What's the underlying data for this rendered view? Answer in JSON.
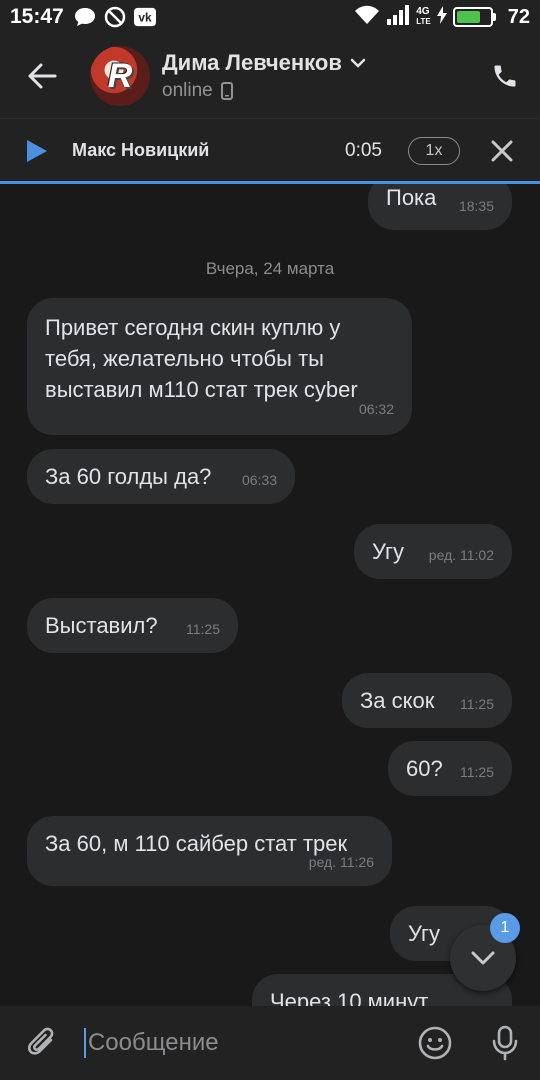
{
  "status_bar": {
    "time": "15:47",
    "net_label": "4G",
    "net_sub": "LTE",
    "battery": "72",
    "battery_level": 0.72
  },
  "header": {
    "contact_name": "Дима Левченков",
    "status": "online",
    "avatar_letter": "R"
  },
  "player": {
    "title": "Макс Новицкий",
    "time": "0:05",
    "speed": "1x"
  },
  "chat": {
    "date_separator": "Вчера, 24 марта",
    "messages": [
      {
        "text": "Пока",
        "time": "18:35",
        "side": "out"
      },
      {
        "text": "Привет сегодня скин куплю у тебя, желательно чтобы ты выставил м110 стат трек cyber",
        "time": "06:32",
        "side": "in"
      },
      {
        "text": "За 60 голды да?",
        "time": "06:33",
        "side": "in"
      },
      {
        "text": "Угу",
        "time": "ред. 11:02",
        "side": "out"
      },
      {
        "text": "Выставил?",
        "time": "11:25",
        "side": "in"
      },
      {
        "text": "За скок",
        "time": "11:25",
        "side": "out"
      },
      {
        "text": "60?",
        "time": "11:25",
        "side": "out"
      },
      {
        "text": "За 60, м 110 сайбер стат трек",
        "time": "ред. 11:26",
        "side": "in"
      },
      {
        "text": "Угу",
        "time": "",
        "side": "out"
      },
      {
        "text": "Через 10 минут",
        "time": "",
        "side": "out"
      }
    ]
  },
  "scroll_down": {
    "unread": "1"
  },
  "composer": {
    "placeholder": "Сообщение"
  },
  "colors": {
    "background": "#191919",
    "bar": "#222222",
    "bubble": "#2c2d2e",
    "accent": "#4b8fe2",
    "battery": "#4fc24c"
  },
  "icons": [
    "message-icon",
    "dnd-icon",
    "vk-icon",
    "wifi-icon",
    "signal-icon",
    "battery-icon",
    "back-arrow-icon",
    "chevron-down-icon",
    "phone-mobile-icon",
    "phone-icon",
    "play-icon",
    "close-icon",
    "chevron-down-icon",
    "attach-icon",
    "emoji-icon",
    "mic-icon"
  ]
}
